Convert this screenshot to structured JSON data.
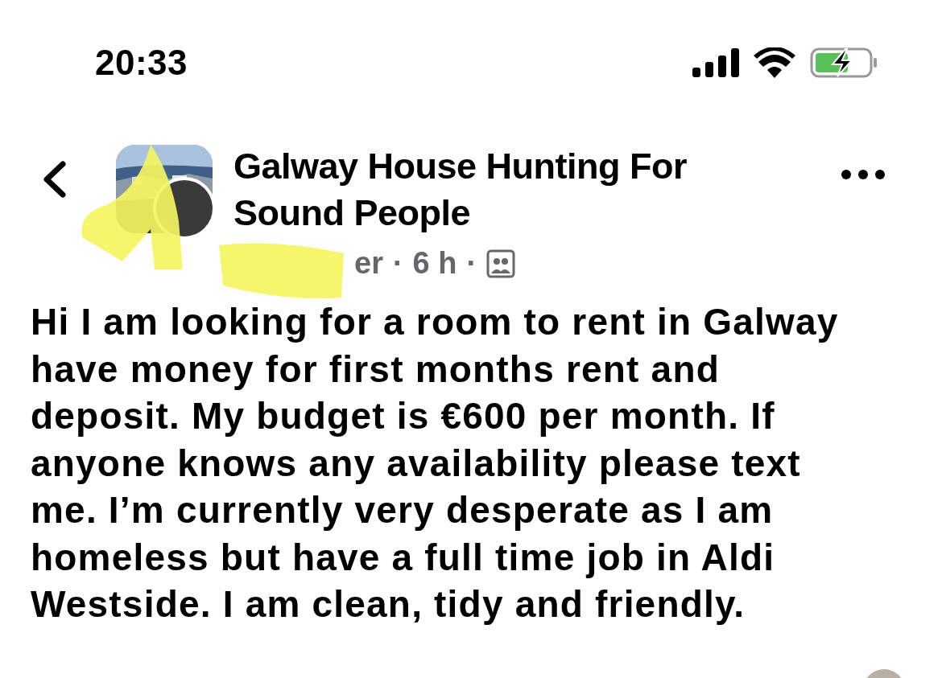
{
  "status_bar": {
    "time": "20:33"
  },
  "header": {
    "title": "Galway House Hunting For Sound People",
    "meta": {
      "author": "er",
      "separators": [
        "·",
        "·"
      ],
      "time": "6 h"
    }
  },
  "post": {
    "text": "Hi I am looking for a room to rent in Galway have money for first months rent and deposit. My budget is €600 per month. If anyone knows any availability please text me. I’m currently very desperate as I am homeless but have a full time job in Aldi Westside.  I am clean, tidy and friendly."
  }
}
